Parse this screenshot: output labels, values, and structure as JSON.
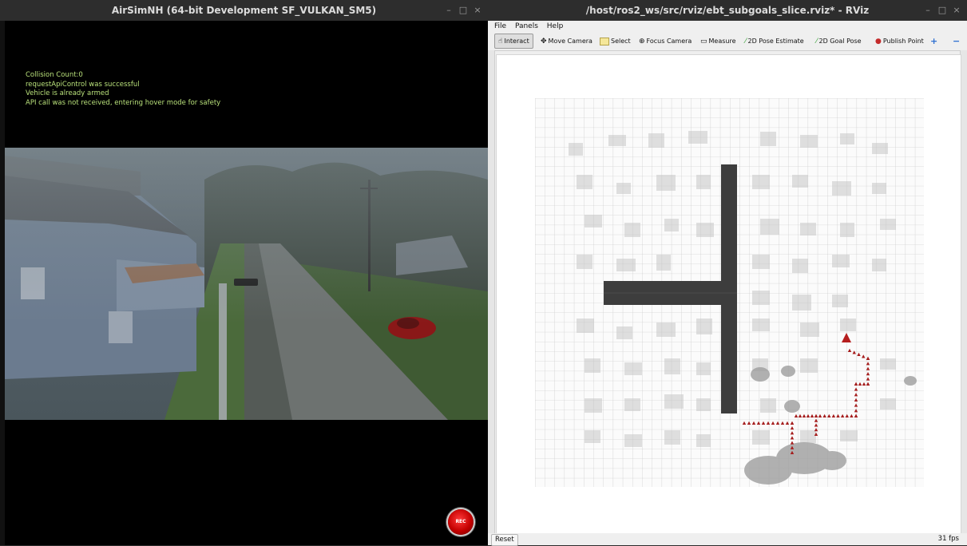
{
  "airsim": {
    "title": "AirSimNH (64-bit Development SF_VULKAN_SM5)",
    "window_controls": [
      "–",
      "□",
      "×"
    ],
    "overlay": [
      "Collision Count:0",
      "requestApiControl was successful",
      "Vehicle is already armed",
      "API call was not received, entering hover mode for safety"
    ],
    "rec_label": "REC"
  },
  "rviz": {
    "title": "/host/ros2_ws/src/rviz/ebt_subgoals_slice.rviz* - RViz",
    "window_controls": [
      "–",
      "□",
      "×"
    ],
    "menu": {
      "file": "File",
      "panels": "Panels",
      "help": "Help"
    },
    "toolbar": {
      "interact": "Interact",
      "move_camera": "Move Camera",
      "select": "Select",
      "focus_camera": "Focus Camera",
      "measure": "Measure",
      "pose_estimate": "2D Pose Estimate",
      "goal_pose": "2D Goal Pose",
      "publish_point": "Publish Point",
      "add": "+",
      "remove": "−"
    },
    "status": {
      "reset": "Reset",
      "fps": "31 fps"
    },
    "colors": {
      "path": "#a51d1d",
      "wall": "#3d3d3d",
      "grid": "#bdbdbd"
    }
  }
}
